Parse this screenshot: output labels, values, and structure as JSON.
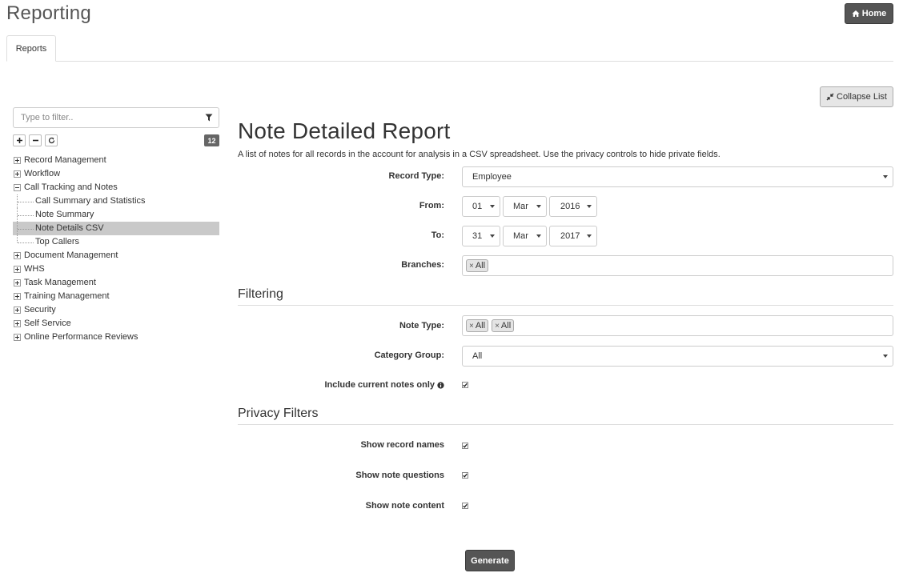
{
  "header": {
    "title": "Reporting",
    "home_label": "Home"
  },
  "tabs": [
    {
      "label": "Reports",
      "active": true
    }
  ],
  "collapse_label": "Collapse List",
  "sidebar": {
    "filter_placeholder": "Type to filter..",
    "count": "12",
    "items": [
      {
        "label": "Record Management",
        "type": "group",
        "expanded": false
      },
      {
        "label": "Workflow",
        "type": "group",
        "expanded": false
      },
      {
        "label": "Call Tracking and Notes",
        "type": "group",
        "expanded": true
      },
      {
        "label": "Call Summary and Statistics",
        "type": "child"
      },
      {
        "label": "Note Summary",
        "type": "child"
      },
      {
        "label": "Note Details CSV",
        "type": "child",
        "selected": true
      },
      {
        "label": "Top Callers",
        "type": "child",
        "last": true
      },
      {
        "label": "Document Management",
        "type": "group",
        "expanded": false
      },
      {
        "label": "WHS",
        "type": "group",
        "expanded": false
      },
      {
        "label": "Task Management",
        "type": "group",
        "expanded": false
      },
      {
        "label": "Training Management",
        "type": "group",
        "expanded": false
      },
      {
        "label": "Security",
        "type": "group",
        "expanded": false
      },
      {
        "label": "Self Service",
        "type": "group",
        "expanded": false
      },
      {
        "label": "Online Performance Reviews",
        "type": "group",
        "expanded": false
      }
    ]
  },
  "report": {
    "title": "Note Detailed Report",
    "description": "A list of notes for all records in the account for analysis in a CSV spreadsheet. Use the privacy controls to hide private fields.",
    "record_type": {
      "label": "Record Type:",
      "value": "Employee"
    },
    "from": {
      "label": "From:",
      "day": "01",
      "month": "Mar",
      "year": "2016"
    },
    "to": {
      "label": "To:",
      "day": "31",
      "month": "Mar",
      "year": "2017"
    },
    "branches": {
      "label": "Branches:",
      "tags": [
        "All"
      ]
    }
  },
  "filtering": {
    "heading": "Filtering",
    "note_type": {
      "label": "Note Type:",
      "tags": [
        "All",
        "All"
      ]
    },
    "category_group": {
      "label": "Category Group:",
      "value": "All"
    },
    "current_only": {
      "label": "Include current notes only",
      "checked": true
    }
  },
  "privacy": {
    "heading": "Privacy Filters",
    "show_record_names": {
      "label": "Show record names",
      "checked": true
    },
    "show_note_questions": {
      "label": "Show note questions",
      "checked": true
    },
    "show_note_content": {
      "label": "Show note content",
      "checked": true
    }
  },
  "generate_label": "Generate",
  "colors": {
    "dark_button": "#555555",
    "selected_row": "#c9c9c9",
    "tag_bg": "#e4e4e4"
  }
}
